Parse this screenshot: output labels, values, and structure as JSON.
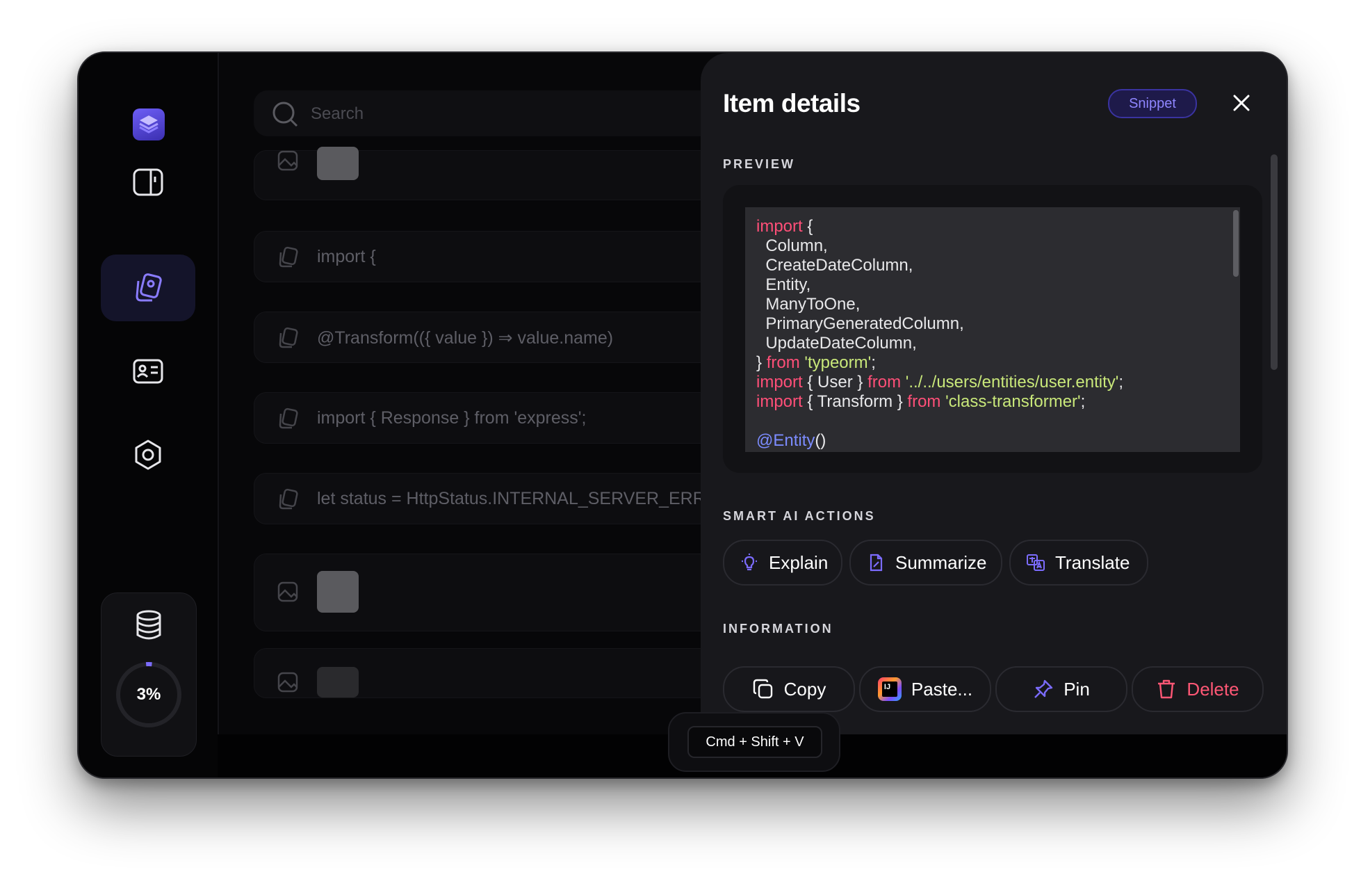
{
  "search": {
    "placeholder": "Search"
  },
  "list": {
    "items": [
      {
        "type": "image"
      },
      {
        "type": "snippet",
        "text": "import {"
      },
      {
        "type": "snippet",
        "text": "@Transform(({ value }) ⇒ value.name)"
      },
      {
        "type": "snippet",
        "text": "import { Response } from 'express';"
      },
      {
        "type": "snippet",
        "text": "let status = HttpStatus.INTERNAL_SERVER_ERRC"
      },
      {
        "type": "image"
      },
      {
        "type": "image"
      }
    ]
  },
  "sidebar": {
    "storage_percent": "3%",
    "storage_fraction": 0.03,
    "icons": [
      "app-logo-icon",
      "panel-toggle-icon",
      "clipboard-icon",
      "contact-card-icon",
      "settings-icon",
      "database-icon"
    ]
  },
  "details": {
    "title": "Item details",
    "badge": "Snippet",
    "preview_label": "PREVIEW",
    "ai_label": "SMART AI ACTIONS",
    "info_label": "INFORMATION",
    "code_lines": [
      [
        {
          "t": "import",
          "c": "kw"
        },
        {
          "t": " {",
          "c": ""
        }
      ],
      [
        {
          "t": "  Column,",
          "c": ""
        }
      ],
      [
        {
          "t": "  CreateDateColumn,",
          "c": ""
        }
      ],
      [
        {
          "t": "  Entity,",
          "c": ""
        }
      ],
      [
        {
          "t": "  ManyToOne,",
          "c": ""
        }
      ],
      [
        {
          "t": "  PrimaryGeneratedColumn,",
          "c": ""
        }
      ],
      [
        {
          "t": "  UpdateDateColumn,",
          "c": ""
        }
      ],
      [
        {
          "t": "} ",
          "c": ""
        },
        {
          "t": "from",
          "c": "kw"
        },
        {
          "t": " ",
          "c": ""
        },
        {
          "t": "'typeorm'",
          "c": "str"
        },
        {
          "t": ";",
          "c": ""
        }
      ],
      [
        {
          "t": "import",
          "c": "kw"
        },
        {
          "t": " { User } ",
          "c": ""
        },
        {
          "t": "from",
          "c": "kw"
        },
        {
          "t": " ",
          "c": ""
        },
        {
          "t": "'../../users/entities/user.entity'",
          "c": "str"
        },
        {
          "t": ";",
          "c": ""
        }
      ],
      [
        {
          "t": "import",
          "c": "kw"
        },
        {
          "t": " { Transform } ",
          "c": ""
        },
        {
          "t": "from",
          "c": "kw"
        },
        {
          "t": " ",
          "c": ""
        },
        {
          "t": "'class-transformer'",
          "c": "str"
        },
        {
          "t": ";",
          "c": ""
        }
      ],
      [
        {
          "t": "",
          "c": ""
        }
      ],
      [
        {
          "t": "@Entity",
          "c": "dec"
        },
        {
          "t": "()",
          "c": ""
        }
      ]
    ],
    "ai_actions": {
      "explain": "Explain",
      "summarize": "Summarize",
      "translate": "Translate"
    },
    "actions": {
      "copy": "Copy",
      "paste": "Paste...",
      "pin": "Pin",
      "delete": "Delete"
    }
  },
  "shortcut": "Cmd + Shift + V",
  "colors": {
    "accent": "#7c6cff",
    "keyword": "#ff4f78",
    "string": "#c9e87a",
    "danger": "#ff5775"
  }
}
